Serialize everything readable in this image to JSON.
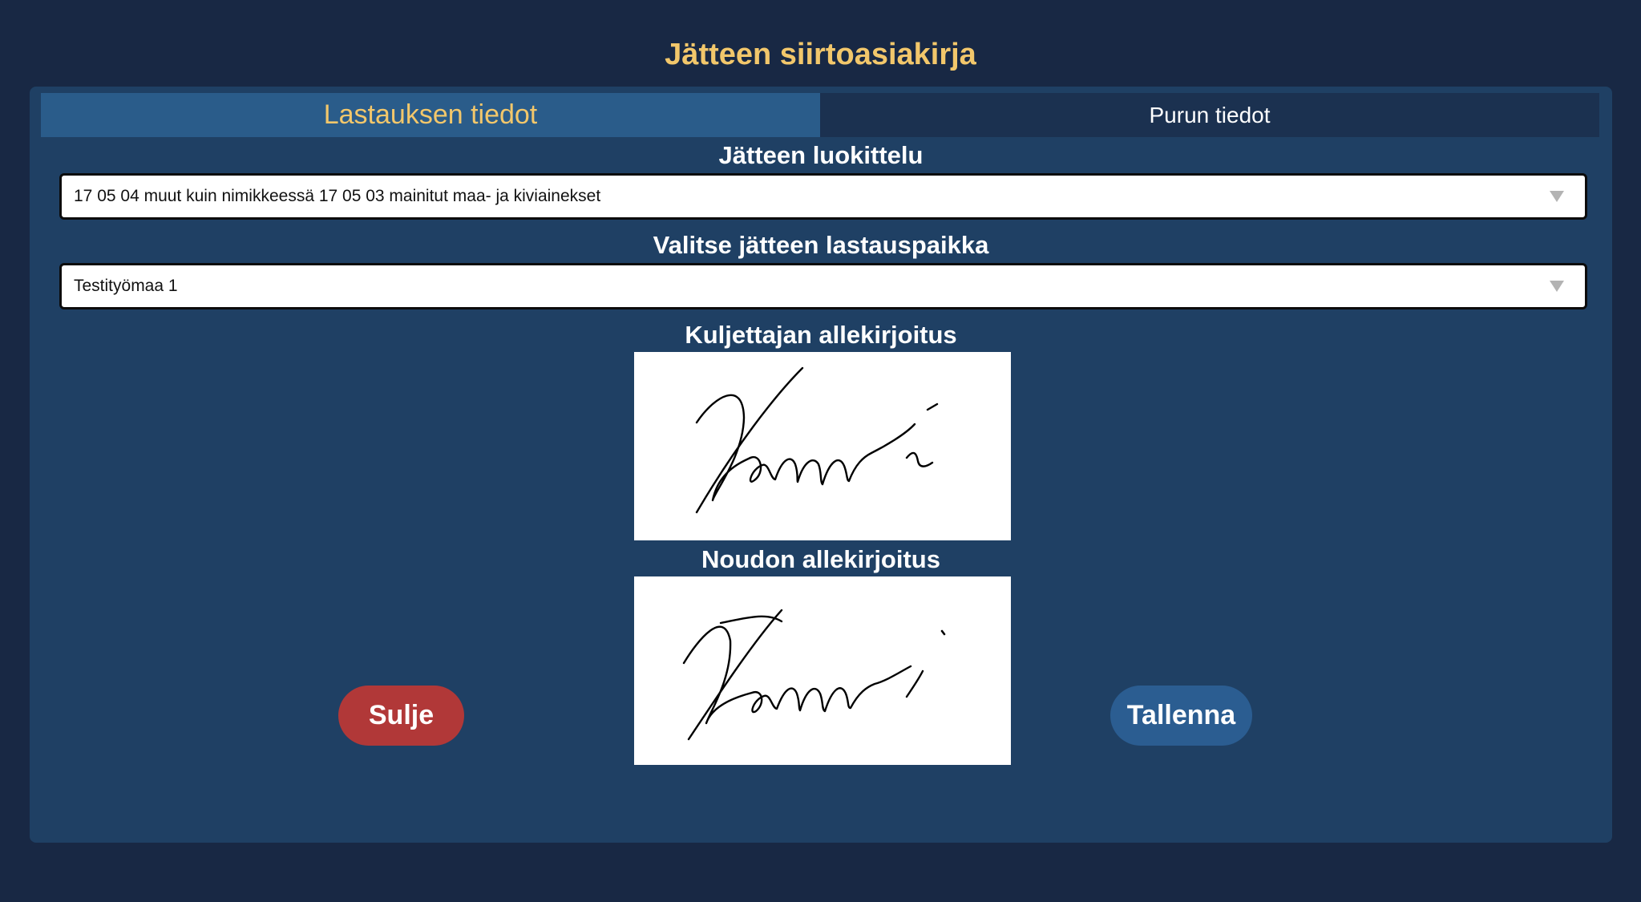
{
  "page": {
    "title": "Jätteen siirtoasiakirja"
  },
  "tabs": [
    {
      "label": "Lastauksen tiedot",
      "active": true
    },
    {
      "label": "Purun tiedot",
      "active": false
    }
  ],
  "waste_classification": {
    "label": "Jätteen luokittelu",
    "value": "17 05 04 muut kuin nimikkeessä 17 05 03 mainitut maa- ja kiviainekset",
    "icon": "dropdown-arrow-icon"
  },
  "loading_site": {
    "label": "Valitse jätteen lastauspaikka",
    "value": "Testityömaa 1",
    "icon": "dropdown-arrow-icon"
  },
  "driver_signature": {
    "label": "Kuljettajan allekirjoitus",
    "signature_text": "Hanni"
  },
  "pickup_signature": {
    "label": "Noudon allekirjoitus",
    "signature_text": "Hanni"
  },
  "buttons": {
    "close_label": "Sulje",
    "save_label": "Tallenna"
  },
  "colors": {
    "background": "#182844",
    "panel": "#1f4064",
    "accent": "#f2c76b",
    "active_tab": "#2a5c8a",
    "inactive_tab": "#1b3150",
    "close_button": "#b13838",
    "save_button": "#2b5d91"
  }
}
